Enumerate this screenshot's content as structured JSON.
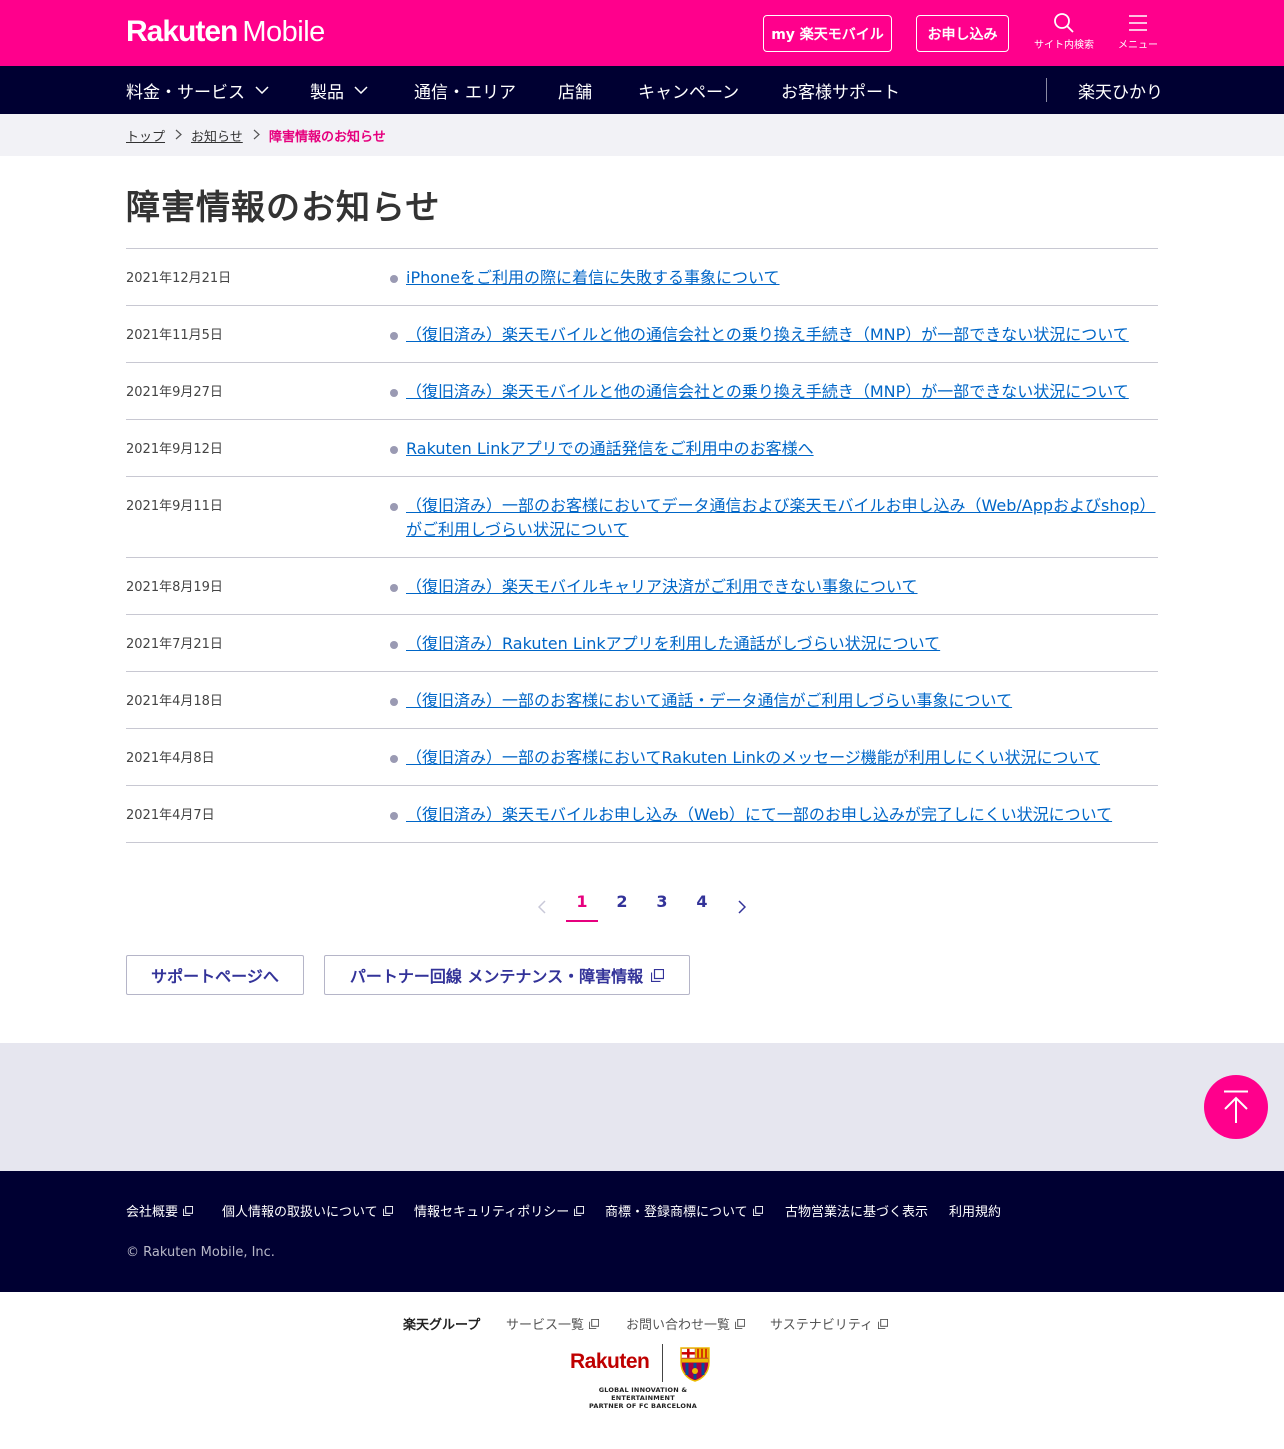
{
  "header": {
    "logo_bold": "Rakuten",
    "logo_light": "Mobile",
    "my_button": "my 楽天モバイル",
    "apply_button": "お申し込み",
    "search_label": "サイト内検索",
    "menu_label": "メニュー",
    "brand_color": "#ff008c"
  },
  "nav": {
    "items": [
      "料金・サービス",
      "製品",
      "通信・エリア",
      "店舗",
      "キャンペーン",
      "お客様サポート"
    ],
    "right_item": "楽天ひかり"
  },
  "breadcrumb": {
    "home": "トップ",
    "parent": "お知らせ",
    "current": "障害情報のお知らせ"
  },
  "page_title": "障害情報のお知らせ",
  "notices": [
    {
      "date": "2021年12月21日",
      "title": "iPhoneをご利用の際に着信に失敗する事象について"
    },
    {
      "date": "2021年11月5日",
      "title": "（復旧済み）楽天モバイルと他の通信会社との乗り換え手続き（MNP）が一部できない状況について"
    },
    {
      "date": "2021年9月27日",
      "title": "（復旧済み）楽天モバイルと他の通信会社との乗り換え手続き（MNP）が一部できない状況について"
    },
    {
      "date": "2021年9月12日",
      "title": "Rakuten Linkアプリでの通話発信をご利用中のお客様へ"
    },
    {
      "date": "2021年9月11日",
      "title": "（復旧済み）一部のお客様においてデータ通信および楽天モバイルお申し込み（Web/Appおよびshop）がご利用しづらい状況について"
    },
    {
      "date": "2021年8月19日",
      "title": "（復旧済み）楽天モバイルキャリア決済がご利用できない事象について"
    },
    {
      "date": "2021年7月21日",
      "title": "（復旧済み）Rakuten Linkアプリを利用した通話がしづらい状況について"
    },
    {
      "date": "2021年4月18日",
      "title": "（復旧済み）一部のお客様において通話・データ通信がご利用しづらい事象について"
    },
    {
      "date": "2021年4月8日",
      "title": "（復旧済み）一部のお客様においてRakuten Linkのメッセージ機能が利用しにくい状況について"
    },
    {
      "date": "2021年4月7日",
      "title": "（復旧済み）楽天モバイルお申し込み（Web）にて一部のお申し込みが完了しにくい状況について"
    }
  ],
  "pagination": {
    "pages": [
      "1",
      "2",
      "3",
      "4"
    ],
    "current": "1"
  },
  "buttons": {
    "support": "サポートページへ",
    "partner": "パートナー回線 メンテナンス・障害情報"
  },
  "footer": {
    "links": [
      "会社概要",
      "個人情報の取扱いについて",
      "情報セキュリティポリシー",
      "商標・登録商標について",
      "古物営業法に基づく表示",
      "利用規約"
    ],
    "copyright": "© Rakuten Mobile, Inc."
  },
  "group_footer": {
    "group_label": "楽天グループ",
    "links": [
      "サービス一覧",
      "お問い合わせ一覧",
      "サステナビリティ"
    ],
    "partner_logo": "Rakuten",
    "partner_tagline_1": "GLOBAL INNOVATION & ENTERTAINMENT",
    "partner_tagline_2": "PARTNER OF FC BARCELONA"
  }
}
